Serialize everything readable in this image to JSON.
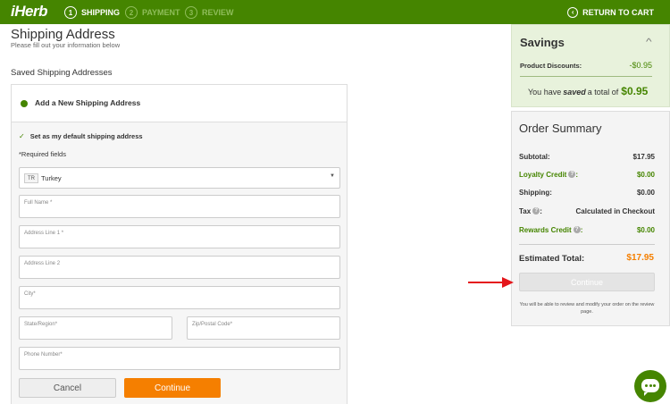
{
  "header": {
    "logo": "iHerb",
    "steps": [
      {
        "num": "1",
        "label": "SHIPPING"
      },
      {
        "num": "2",
        "label": "PAYMENT"
      },
      {
        "num": "3",
        "label": "REVIEW"
      }
    ],
    "return_label": "RETURN TO CART",
    "return_icon": "chevron-left-circle-icon"
  },
  "main": {
    "title": "Shipping Address",
    "subtitle": "Please fill out your information below",
    "saved_heading": "Saved Shipping Addresses",
    "add_new_label": "Add a New Shipping Address",
    "default_label": "Set as my default shipping address",
    "required_label": "*Required fields",
    "country": {
      "code": "TR",
      "name": "Turkey"
    },
    "fields": {
      "full_name": "Full Name *",
      "address1": "Address Line 1 *",
      "address2": "Address Line 2",
      "city": "City*",
      "state": "State/Region*",
      "zip": "Zip/Postal Code*",
      "phone": "Phone Number*"
    },
    "cancel_label": "Cancel",
    "continue_label": "Continue"
  },
  "savings": {
    "title": "Savings",
    "product_discounts_label": "Product Discounts:",
    "product_discounts_value": "-$0.95",
    "total_prefix": "You have",
    "total_em": "saved",
    "total_mid": "a total of",
    "total_value": "$0.95"
  },
  "summary": {
    "title": "Order Summary",
    "rows": [
      {
        "label": "Subtotal:",
        "value": "$17.95"
      },
      {
        "label": "Loyalty Credit",
        "value": "$0.00"
      },
      {
        "label": "Shipping:",
        "value": "$0.00"
      },
      {
        "label": "Tax",
        "value": "Calculated in Checkout"
      },
      {
        "label": "Rewards Credit",
        "value": "$0.00"
      }
    ],
    "estimated_label": "Estimated Total:",
    "estimated_value": "$17.95",
    "continue_label": "Continue",
    "note": "You will be able to review and modify your order on the review page."
  },
  "colors": {
    "brand_green": "#458500",
    "accent_orange": "#f57f00",
    "arrow_red": "#e4161b"
  }
}
